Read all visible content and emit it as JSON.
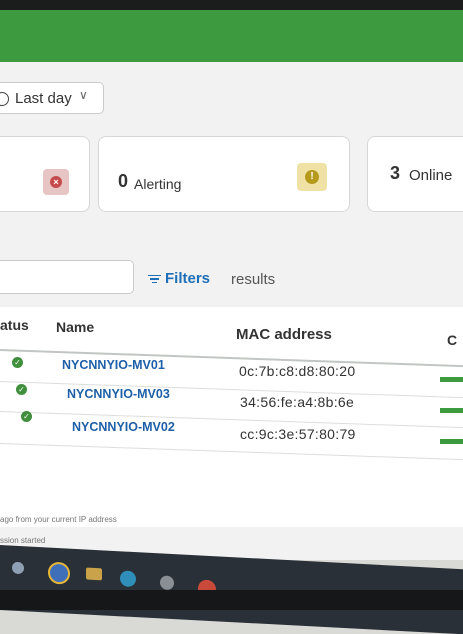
{
  "filter": {
    "time_range": "Last day"
  },
  "summary": {
    "alerting_count": "0",
    "alerting_label": "Alerting",
    "online_count": "3",
    "online_label": "Online"
  },
  "toolbar": {
    "search_placeholder": "",
    "filters_label": "Filters",
    "results_label": "results"
  },
  "table": {
    "columns": [
      "atus",
      "Name",
      "MAC address",
      "C"
    ],
    "rows": [
      {
        "name": "NYCNNYIO-MV01",
        "mac": "0c:7b:c8:d8:80:20",
        "status": "online"
      },
      {
        "name": "NYCNNYIO-MV03",
        "mac": "34:56:fe:a4:8b:6e",
        "status": "online"
      },
      {
        "name": "NYCNNYIO-MV02",
        "mac": "cc:9c:3e:57:80:79",
        "status": "online"
      }
    ]
  },
  "footer": {
    "line1": "ago from your current IP address",
    "line2": "ssion started"
  },
  "colors": {
    "brand_green": "#3e9a3f",
    "link_blue": "#1d6fb8",
    "alert_red": "#c74a4a",
    "warning_yellow": "#b59a1c"
  },
  "icons": [
    "clock-icon",
    "chevron-down-icon",
    "x-circle-icon",
    "exclamation-icon",
    "filter-icon",
    "check-circle-icon"
  ]
}
